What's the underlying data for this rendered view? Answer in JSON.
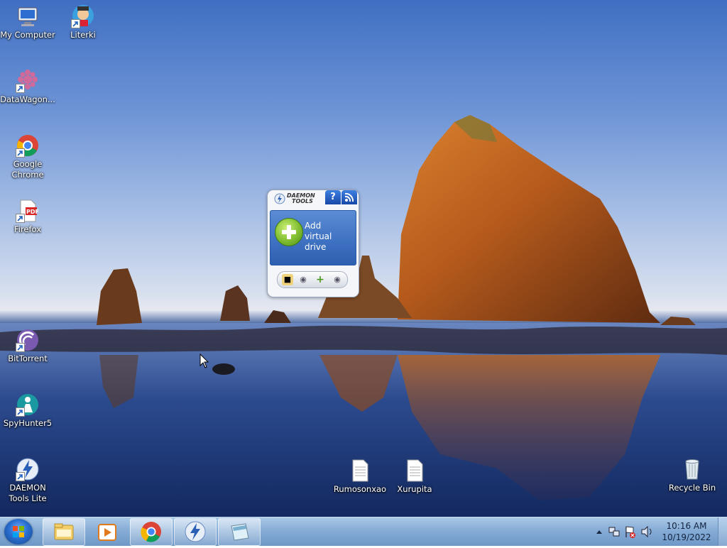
{
  "desktop": {
    "icons": [
      {
        "label": "My Computer",
        "icon": "computer-icon"
      },
      {
        "label": "Literki",
        "icon": "literki-icon"
      },
      {
        "label": "DataWagon...",
        "icon": "datawagon-icon"
      },
      {
        "label": "Google Chrome",
        "icon": "chrome-icon"
      },
      {
        "label": "Firefox",
        "icon": "pdf-file-icon"
      },
      {
        "label": "BitTorrent",
        "icon": "bittorrent-icon"
      },
      {
        "label": "SpyHunter5",
        "icon": "spyhunter-icon"
      },
      {
        "label": "DAEMON Tools Lite",
        "icon": "daemon-tools-icon"
      },
      {
        "label": "Rumosonxao",
        "icon": "text-file-icon"
      },
      {
        "label": "Xurupita",
        "icon": "text-file-icon"
      },
      {
        "label": "Recycle Bin",
        "icon": "recycle-bin-icon"
      }
    ]
  },
  "gadget": {
    "logo_line1": "DAEMON",
    "logo_line2": "TOOLS",
    "help_label": "?",
    "add_line1": "Add",
    "add_line2": "virtual drive"
  },
  "taskbar": {
    "pinned": [
      "file-explorer-icon",
      "media-player-icon",
      "chrome-icon",
      "daemon-tools-icon",
      "notepad-icon"
    ],
    "time": "10:16 AM",
    "date": "10/19/2022"
  },
  "colors": {
    "taskbar": "#86acd6",
    "gadget_panel": "#3f72c2",
    "add_button": "#8cc63a"
  }
}
